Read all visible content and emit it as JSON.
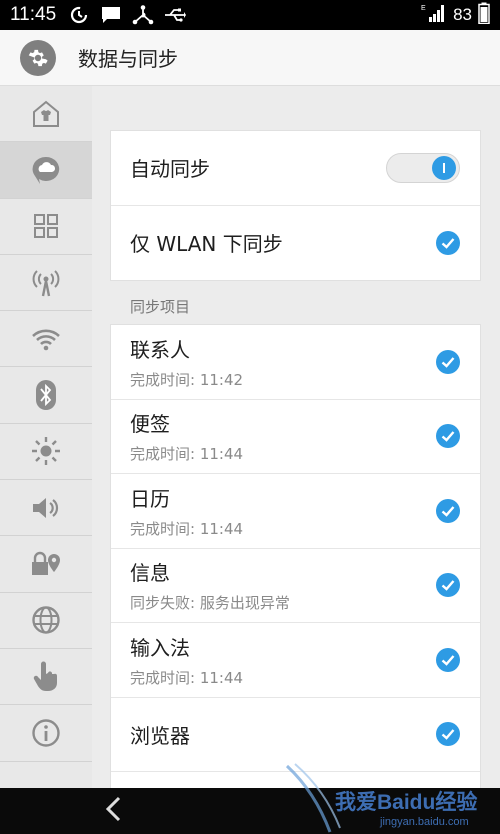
{
  "status_bar": {
    "time": "11:45",
    "battery": "83",
    "icons": [
      "sync-icon",
      "message-icon",
      "usb-share-icon",
      "usb-icon",
      "signal-icon",
      "battery-icon"
    ]
  },
  "app_bar": {
    "title": "数据与同步",
    "icon": "gear-icon"
  },
  "sidebar": {
    "items": [
      {
        "icon": "theme-shirt-icon",
        "active": false
      },
      {
        "icon": "cloud-sync-icon",
        "active": true
      },
      {
        "icon": "apps-grid-icon",
        "active": false
      },
      {
        "icon": "hotspot-icon",
        "active": false
      },
      {
        "icon": "wifi-icon",
        "active": false
      },
      {
        "icon": "bluetooth-icon",
        "active": false
      },
      {
        "icon": "brightness-icon",
        "active": false
      },
      {
        "icon": "volume-icon",
        "active": false
      },
      {
        "icon": "privacy-location-icon",
        "active": false
      },
      {
        "icon": "globe-icon",
        "active": false
      },
      {
        "icon": "gesture-hand-icon",
        "active": false
      },
      {
        "icon": "info-icon",
        "active": false
      }
    ]
  },
  "settings": {
    "auto_sync": {
      "label": "自动同步",
      "on": true
    },
    "wlan_only": {
      "label": "仅 WLAN 下同步",
      "checked": true
    }
  },
  "sync_section": {
    "title": "同步项目",
    "items": [
      {
        "label": "联系人",
        "sub": "完成时间: 11:42",
        "checked": true
      },
      {
        "label": "便签",
        "sub": "完成时间: 11:44",
        "checked": true
      },
      {
        "label": "日历",
        "sub": "完成时间: 11:44",
        "checked": true
      },
      {
        "label": "信息",
        "sub": "同步失败: 服务出现异常",
        "checked": true
      },
      {
        "label": "输入法",
        "sub": "完成时间: 11:44",
        "checked": true
      },
      {
        "label": "浏览器",
        "sub": "",
        "checked": true
      }
    ]
  },
  "navbar": {
    "back_icon": "back-chevron-icon"
  },
  "watermark": {
    "text": "我爱Baidu经验",
    "url": "jingyan.baidu.com"
  },
  "colors": {
    "accent": "#2e9be4",
    "status_bar": "#000000",
    "rail": "#e8e8e8"
  }
}
